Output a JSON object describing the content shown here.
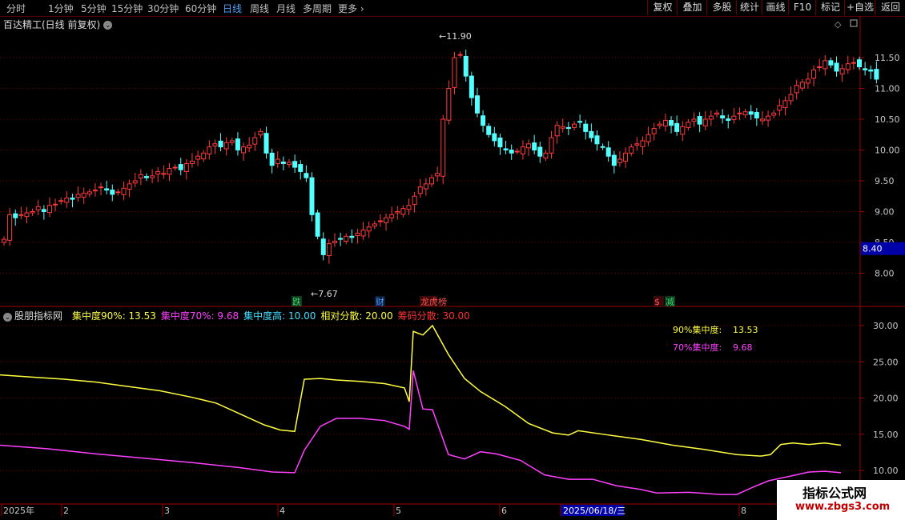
{
  "period_tabs": [
    "分时",
    "1分钟",
    "5分钟",
    "15分钟",
    "30分钟",
    "60分钟",
    "日线",
    "周线",
    "月线",
    "多周期",
    "更多"
  ],
  "active_tab": "日线",
  "right_buttons": [
    "复权",
    "叠加",
    "多股",
    "统计",
    "画线",
    "F10",
    "标记",
    "+自选",
    "返回"
  ],
  "main_title": "百达精工(日线 前复权)",
  "price_axis": [
    "11.50",
    "11.00",
    "10.50",
    "10.00",
    "9.50",
    "9.00",
    "8.50",
    "8.00"
  ],
  "cursor_price": "8.40",
  "high_label": "11.90",
  "low_label": "7.67",
  "event_markers": [
    {
      "text": "跌",
      "color": "#3ad36b",
      "bg": "#0e3a1e"
    },
    {
      "text": "财",
      "color": "#4ea3ff",
      "bg": "#0a1a3a"
    },
    {
      "text": "龙虎榜",
      "color": "#ff5050",
      "bg": "#3a0a0a"
    },
    {
      "text": "$",
      "color": "#ff5050",
      "bg": "#3a0a0a"
    },
    {
      "text": "减",
      "color": "#3ad36b",
      "bg": "#0e3a1e"
    }
  ],
  "indicator": {
    "name": "股朋指标网",
    "items": [
      {
        "label": "集中度90%: 13.53",
        "color": "#ffff40"
      },
      {
        "label": "集中度70%: 9.68",
        "color": "#ff40ff"
      },
      {
        "label": "集中度高: 10.00",
        "color": "#40e0ff"
      },
      {
        "label": "相对分散: 20.00",
        "color": "#ffff40"
      },
      {
        "label": "筹码分散: 30.00",
        "color": "#ff3030"
      }
    ],
    "inset": [
      {
        "name": "90%集中度:",
        "value": "13.53",
        "color": "#ffff40"
      },
      {
        "name": "70%集中度:",
        "value": "9.68",
        "color": "#ff40ff"
      }
    ],
    "axis": [
      "30.00",
      "25.00",
      "20.00",
      "15.00",
      "10.00"
    ]
  },
  "date_axis": [
    "2025年",
    "2",
    "3",
    "4",
    "5",
    "6",
    "2025/06/18/三",
    "8"
  ],
  "watermark": {
    "line1": "指标公式网",
    "line2": "www.zbgs3.com"
  },
  "colors": {
    "up": "#ff3b3b",
    "down": "#54ffff",
    "grid": "#7a0000",
    "axisline": "#a00000"
  }
}
